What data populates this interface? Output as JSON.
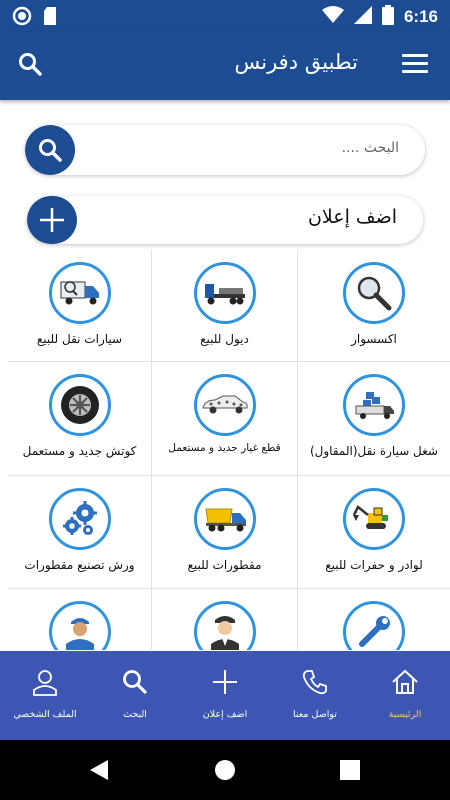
{
  "status_bar": {
    "time": "6:16"
  },
  "app_bar": {
    "title": "تطبيق دفرنس"
  },
  "search": {
    "placeholder": "البحث ...."
  },
  "add_listing": {
    "label": "اضف إعلان"
  },
  "categories": [
    {
      "label": "اكسسوار",
      "icon": "magnifier-icon"
    },
    {
      "label": "ديول للبيع",
      "icon": "flatbed-truck-icon"
    },
    {
      "label": "سيارات نقل للبيع",
      "icon": "truck-search-icon"
    },
    {
      "label": "شغل سيارة نقل(المقاول)",
      "icon": "delivery-truck-icon"
    },
    {
      "label": "قطع غيار جديد و مستعمل",
      "icon": "spare-parts-car-icon"
    },
    {
      "label": "كوتش جديد و مستعمل",
      "icon": "tire-icon"
    },
    {
      "label": "لوادر و حفرات للبيع",
      "icon": "excavator-icon"
    },
    {
      "label": "مقطورات للبيع",
      "icon": "dump-truck-icon"
    },
    {
      "label": "ورش تصنيع مقطورات",
      "icon": "gears-icon"
    },
    {
      "label": "",
      "icon": "wrench-icon"
    },
    {
      "label": "",
      "icon": "driver-icon"
    },
    {
      "label": "",
      "icon": "mechanic-icon"
    }
  ],
  "bottom_nav": [
    {
      "label": "الرئيسية",
      "icon": "home-icon",
      "active": true
    },
    {
      "label": "تواصل معنا",
      "icon": "phone-icon",
      "active": false
    },
    {
      "label": "اضف إعلان",
      "icon": "plus-icon",
      "active": false
    },
    {
      "label": "البحث",
      "icon": "search-icon",
      "active": false
    },
    {
      "label": "الملف الشخصي",
      "icon": "profile-icon",
      "active": false
    }
  ],
  "colors": {
    "primary": "#1c4d92",
    "nav": "#3d56b3",
    "accent_ring": "#2f93dd",
    "active_nav": "#f4c06a"
  }
}
